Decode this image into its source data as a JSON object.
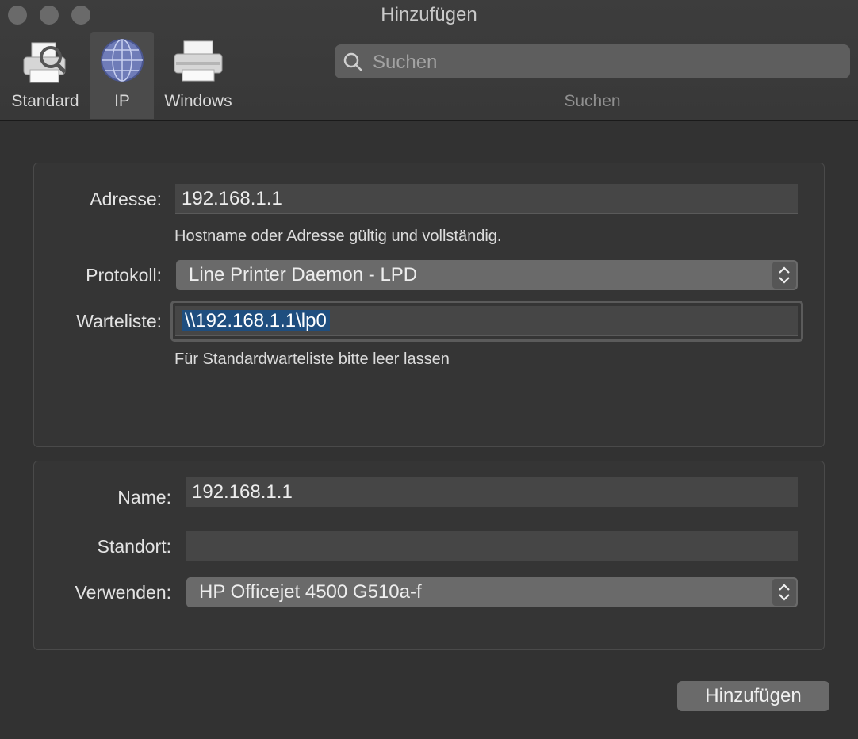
{
  "window": {
    "title": "Hinzufügen"
  },
  "toolbar": {
    "items": [
      {
        "label": "Standard",
        "icon": "printer-magnifier-icon",
        "selected": false
      },
      {
        "label": "IP",
        "icon": "globe-icon",
        "selected": true
      },
      {
        "label": "Windows",
        "icon": "printer-icon",
        "selected": false
      }
    ],
    "search": {
      "placeholder": "Suchen",
      "caption": "Suchen"
    }
  },
  "connection": {
    "address_label": "Adresse:",
    "address_value": "192.168.1.1",
    "address_hint": "Hostname oder Adresse gültig und vollständig.",
    "protocol_label": "Protokoll:",
    "protocol_value": "Line Printer Daemon - LPD",
    "queue_label": "Warteliste:",
    "queue_value": "\\\\192.168.1.1\\lp0",
    "queue_hint": "Für Standardwarteliste bitte leer lassen"
  },
  "printer": {
    "name_label": "Name:",
    "name_value": "192.168.1.1",
    "location_label": "Standort:",
    "location_value": "",
    "use_label": "Verwenden:",
    "use_value": "HP Officejet 4500 G510a-f"
  },
  "actions": {
    "add_button": "Hinzufügen"
  },
  "colors": {
    "background": "#323232",
    "selection": "#1f4e7f",
    "traffic_light": "#6a6a6a"
  }
}
